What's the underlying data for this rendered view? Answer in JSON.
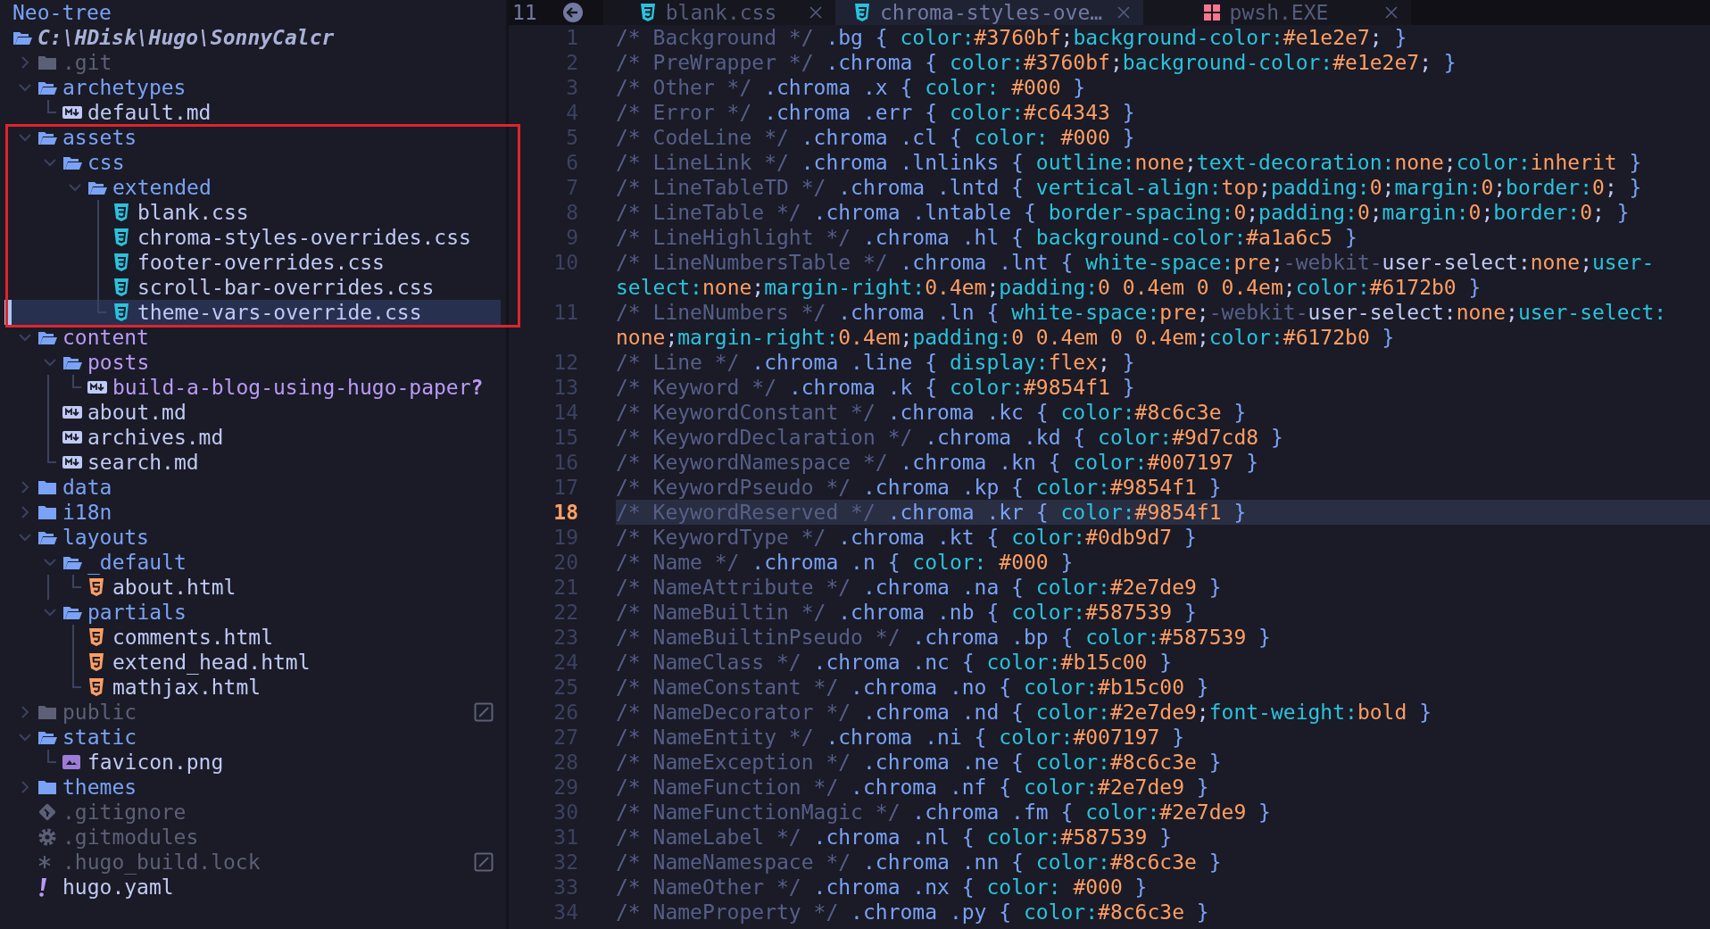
{
  "tree": {
    "title": "Neo-tree",
    "root": "C:\\HDisk\\Hugo\\SonnyCalcr",
    "items": [
      {
        "name": ".git",
        "kind": "folder",
        "expanded": false,
        "ignored": true,
        "untracked": false,
        "selected": false,
        "flagged": false,
        "framed": false
      },
      {
        "name": "archetypes",
        "kind": "folder",
        "expanded": true,
        "ignored": false,
        "untracked": false,
        "selected": false,
        "flagged": false,
        "framed": false,
        "children": [
          {
            "name": "default.md",
            "kind": "md",
            "ignored": false,
            "untracked": false,
            "selected": false,
            "flagged": false
          }
        ]
      },
      {
        "name": "assets",
        "kind": "folder",
        "expanded": true,
        "ignored": false,
        "untracked": false,
        "selected": false,
        "flagged": false,
        "framed": true,
        "children": [
          {
            "name": "css",
            "kind": "folder",
            "expanded": true,
            "ignored": false,
            "untracked": false,
            "selected": false,
            "flagged": false,
            "children": [
              {
                "name": "extended",
                "kind": "folder",
                "expanded": true,
                "ignored": false,
                "untracked": false,
                "selected": false,
                "flagged": false,
                "children": [
                  {
                    "name": "blank.css",
                    "kind": "css",
                    "ignored": false,
                    "untracked": false,
                    "selected": false,
                    "flagged": false
                  },
                  {
                    "name": "chroma-styles-overrides.css",
                    "kind": "css",
                    "ignored": false,
                    "untracked": false,
                    "selected": false,
                    "flagged": false
                  },
                  {
                    "name": "footer-overrides.css",
                    "kind": "css",
                    "ignored": false,
                    "untracked": false,
                    "selected": false,
                    "flagged": false
                  },
                  {
                    "name": "scroll-bar-overrides.css",
                    "kind": "css",
                    "ignored": false,
                    "untracked": false,
                    "selected": false,
                    "flagged": false
                  },
                  {
                    "name": "theme-vars-override.css",
                    "kind": "css",
                    "ignored": false,
                    "untracked": false,
                    "selected": true,
                    "flagged": false
                  }
                ]
              }
            ]
          }
        ]
      },
      {
        "name": "content",
        "kind": "folder",
        "expanded": true,
        "ignored": false,
        "untracked": true,
        "selected": false,
        "flagged": false,
        "framed": false,
        "children": [
          {
            "name": "posts",
            "kind": "folder",
            "expanded": true,
            "ignored": false,
            "untracked": true,
            "selected": false,
            "flagged": false,
            "children": [
              {
                "name": "build-a-blog-using-hugo-paper",
                "kind": "md",
                "ignored": false,
                "untracked": true,
                "status_mark": "?",
                "selected": false,
                "flagged": false
              }
            ]
          },
          {
            "name": "about.md",
            "kind": "md",
            "ignored": false,
            "untracked": false,
            "selected": false,
            "flagged": false
          },
          {
            "name": "archives.md",
            "kind": "md",
            "ignored": false,
            "untracked": false,
            "selected": false,
            "flagged": false
          },
          {
            "name": "search.md",
            "kind": "md",
            "ignored": false,
            "untracked": false,
            "selected": false,
            "flagged": false
          }
        ]
      },
      {
        "name": "data",
        "kind": "folder",
        "expanded": false,
        "ignored": false,
        "untracked": false,
        "selected": false,
        "flagged": false,
        "framed": false
      },
      {
        "name": "i18n",
        "kind": "folder",
        "expanded": false,
        "ignored": false,
        "untracked": false,
        "selected": false,
        "flagged": false,
        "framed": false
      },
      {
        "name": "layouts",
        "kind": "folder",
        "expanded": true,
        "ignored": false,
        "untracked": false,
        "selected": false,
        "flagged": false,
        "framed": false,
        "children": [
          {
            "name": "_default",
            "kind": "folder",
            "expanded": true,
            "ignored": false,
            "untracked": false,
            "selected": false,
            "flagged": false,
            "children": [
              {
                "name": "about.html",
                "kind": "html",
                "ignored": false,
                "untracked": false,
                "selected": false,
                "flagged": false
              }
            ]
          },
          {
            "name": "partials",
            "kind": "folder",
            "expanded": true,
            "ignored": false,
            "untracked": false,
            "selected": false,
            "flagged": false,
            "children": [
              {
                "name": "comments.html",
                "kind": "html",
                "ignored": false,
                "untracked": false,
                "selected": false,
                "flagged": false
              },
              {
                "name": "extend_head.html",
                "kind": "html",
                "ignored": false,
                "untracked": false,
                "selected": false,
                "flagged": false
              },
              {
                "name": "mathjax.html",
                "kind": "html",
                "ignored": false,
                "untracked": false,
                "selected": false,
                "flagged": false
              }
            ]
          }
        ]
      },
      {
        "name": "public",
        "kind": "folder",
        "expanded": false,
        "ignored": true,
        "untracked": false,
        "selected": false,
        "flagged": true,
        "framed": false
      },
      {
        "name": "static",
        "kind": "folder",
        "expanded": true,
        "ignored": false,
        "untracked": false,
        "selected": false,
        "flagged": false,
        "framed": false,
        "children": [
          {
            "name": "favicon.png",
            "kind": "png",
            "ignored": false,
            "untracked": false,
            "selected": false,
            "flagged": false
          }
        ]
      },
      {
        "name": "themes",
        "kind": "folder",
        "expanded": false,
        "ignored": false,
        "untracked": false,
        "selected": false,
        "flagged": false,
        "framed": false
      },
      {
        "name": ".gitignore",
        "kind": "git",
        "ignored": true,
        "untracked": false,
        "selected": false,
        "flagged": false,
        "framed": false
      },
      {
        "name": ".gitmodules",
        "kind": "config",
        "ignored": true,
        "untracked": false,
        "selected": false,
        "flagged": false,
        "framed": false
      },
      {
        "name": ".hugo_build.lock",
        "kind": "lock",
        "ignored": true,
        "untracked": false,
        "selected": false,
        "flagged": true,
        "framed": false
      },
      {
        "name": "hugo.yaml",
        "kind": "yaml",
        "ignored": false,
        "untracked": false,
        "selected": false,
        "flagged": false,
        "framed": false
      }
    ]
  },
  "tabline": {
    "buffer_number": "11",
    "tabs": [
      {
        "label": "blank.css",
        "kind": "css",
        "selected": false
      },
      {
        "label": "chroma-styles-ove…",
        "kind": "css",
        "selected": true
      },
      {
        "label": "pwsh.EXE",
        "kind": "terminal",
        "selected": false
      }
    ]
  },
  "editor": {
    "lines": [
      {
        "number": "1",
        "current": false,
        "tokens": [
          {
            "kind": "comment",
            "text": "/* Background */ "
          },
          {
            "kind": "selector",
            "text": ".bg { "
          },
          {
            "kind": "property",
            "text": "color:"
          },
          {
            "kind": "value",
            "text": "#3760bf"
          },
          {
            "kind": "punct",
            "text": ";"
          },
          {
            "kind": "property",
            "text": "background-color:"
          },
          {
            "kind": "value",
            "text": "#e1e2e7"
          },
          {
            "kind": "punct",
            "text": "; "
          },
          {
            "kind": "selector",
            "text": "}"
          }
        ]
      },
      {
        "number": "2",
        "current": false,
        "tokens": [
          {
            "kind": "comment",
            "text": "/* PreWrapper */ "
          },
          {
            "kind": "selector",
            "text": ".chroma { "
          },
          {
            "kind": "property",
            "text": "color:"
          },
          {
            "kind": "value",
            "text": "#3760bf"
          },
          {
            "kind": "punct",
            "text": ";"
          },
          {
            "kind": "property",
            "text": "background-color:"
          },
          {
            "kind": "value",
            "text": "#e1e2e7"
          },
          {
            "kind": "punct",
            "text": "; "
          },
          {
            "kind": "selector",
            "text": "}"
          }
        ]
      },
      {
        "number": "3",
        "current": false,
        "tokens": [
          {
            "kind": "comment",
            "text": "/* Other */ "
          },
          {
            "kind": "selector",
            "text": ".chroma .x { "
          },
          {
            "kind": "property",
            "text": "color: "
          },
          {
            "kind": "value",
            "text": "#000"
          },
          {
            "kind": "selector",
            "text": " }"
          }
        ]
      },
      {
        "number": "4",
        "current": false,
        "tokens": [
          {
            "kind": "comment",
            "text": "/* Error */ "
          },
          {
            "kind": "selector",
            "text": ".chroma .err { "
          },
          {
            "kind": "property",
            "text": "color:"
          },
          {
            "kind": "value",
            "text": "#c64343"
          },
          {
            "kind": "selector",
            "text": " }"
          }
        ]
      },
      {
        "number": "5",
        "current": false,
        "tokens": [
          {
            "kind": "comment",
            "text": "/* CodeLine */ "
          },
          {
            "kind": "selector",
            "text": ".chroma .cl { "
          },
          {
            "kind": "property",
            "text": "color: "
          },
          {
            "kind": "value",
            "text": "#000"
          },
          {
            "kind": "selector",
            "text": " }"
          }
        ]
      },
      {
        "number": "6",
        "current": false,
        "tokens": [
          {
            "kind": "comment",
            "text": "/* LineLink */ "
          },
          {
            "kind": "selector",
            "text": ".chroma .lnlinks { "
          },
          {
            "kind": "property",
            "text": "outline:"
          },
          {
            "kind": "value",
            "text": "none"
          },
          {
            "kind": "punct",
            "text": ";"
          },
          {
            "kind": "property",
            "text": "text-decoration:"
          },
          {
            "kind": "value",
            "text": "none"
          },
          {
            "kind": "punct",
            "text": ";"
          },
          {
            "kind": "property",
            "text": "color:"
          },
          {
            "kind": "value",
            "text": "inherit"
          },
          {
            "kind": "selector",
            "text": " }"
          }
        ]
      },
      {
        "number": "7",
        "current": false,
        "tokens": [
          {
            "kind": "comment",
            "text": "/* LineTableTD */ "
          },
          {
            "kind": "selector",
            "text": ".chroma .lntd { "
          },
          {
            "kind": "property",
            "text": "vertical-align:"
          },
          {
            "kind": "value",
            "text": "top"
          },
          {
            "kind": "punct",
            "text": ";"
          },
          {
            "kind": "property",
            "text": "padding:"
          },
          {
            "kind": "value",
            "text": "0"
          },
          {
            "kind": "punct",
            "text": ";"
          },
          {
            "kind": "property",
            "text": "margin:"
          },
          {
            "kind": "value",
            "text": "0"
          },
          {
            "kind": "punct",
            "text": ";"
          },
          {
            "kind": "property",
            "text": "border:"
          },
          {
            "kind": "value",
            "text": "0"
          },
          {
            "kind": "punct",
            "text": "; "
          },
          {
            "kind": "selector",
            "text": "}"
          }
        ]
      },
      {
        "number": "8",
        "current": false,
        "tokens": [
          {
            "kind": "comment",
            "text": "/* LineTable */ "
          },
          {
            "kind": "selector",
            "text": ".chroma .lntable { "
          },
          {
            "kind": "property",
            "text": "border-spacing:"
          },
          {
            "kind": "value",
            "text": "0"
          },
          {
            "kind": "punct",
            "text": ";"
          },
          {
            "kind": "property",
            "text": "padding:"
          },
          {
            "kind": "value",
            "text": "0"
          },
          {
            "kind": "punct",
            "text": ";"
          },
          {
            "kind": "property",
            "text": "margin:"
          },
          {
            "kind": "value",
            "text": "0"
          },
          {
            "kind": "punct",
            "text": ";"
          },
          {
            "kind": "property",
            "text": "border:"
          },
          {
            "kind": "value",
            "text": "0"
          },
          {
            "kind": "punct",
            "text": "; "
          },
          {
            "kind": "selector",
            "text": "}"
          }
        ]
      },
      {
        "number": "9",
        "current": false,
        "tokens": [
          {
            "kind": "comment",
            "text": "/* LineHighlight */ "
          },
          {
            "kind": "selector",
            "text": ".chroma .hl { "
          },
          {
            "kind": "property",
            "text": "background-color:"
          },
          {
            "kind": "value",
            "text": "#a1a6c5"
          },
          {
            "kind": "selector",
            "text": " }"
          }
        ]
      },
      {
        "number": "10",
        "current": false,
        "tokens": [
          {
            "kind": "comment",
            "text": "/* LineNumbersTable */ "
          },
          {
            "kind": "selector",
            "text": ".chroma .lnt { "
          },
          {
            "kind": "property",
            "text": "white-space:"
          },
          {
            "kind": "value",
            "text": "pre"
          },
          {
            "kind": "punct",
            "text": ";"
          },
          {
            "kind": "vendor",
            "text": "-webkit-"
          },
          {
            "kind": "plain",
            "text": "user-select:"
          },
          {
            "kind": "value",
            "text": "none"
          },
          {
            "kind": "punct",
            "text": ";"
          },
          {
            "kind": "property",
            "text": "user-"
          }
        ],
        "wrapped": [
          {
            "kind": "property",
            "text": "select:"
          },
          {
            "kind": "value",
            "text": "none"
          },
          {
            "kind": "punct",
            "text": ";"
          },
          {
            "kind": "property",
            "text": "margin-right:"
          },
          {
            "kind": "value",
            "text": "0.4em"
          },
          {
            "kind": "punct",
            "text": ";"
          },
          {
            "kind": "property",
            "text": "padding:"
          },
          {
            "kind": "value",
            "text": "0 0.4em 0 0.4em"
          },
          {
            "kind": "punct",
            "text": ";"
          },
          {
            "kind": "property",
            "text": "color:"
          },
          {
            "kind": "value",
            "text": "#6172b0"
          },
          {
            "kind": "selector",
            "text": " }"
          }
        ]
      },
      {
        "number": "11",
        "current": false,
        "tokens": [
          {
            "kind": "comment",
            "text": "/* LineNumbers */ "
          },
          {
            "kind": "selector",
            "text": ".chroma .ln { "
          },
          {
            "kind": "property",
            "text": "white-space:"
          },
          {
            "kind": "value",
            "text": "pre"
          },
          {
            "kind": "punct",
            "text": ";"
          },
          {
            "kind": "vendor",
            "text": "-webkit-"
          },
          {
            "kind": "plain",
            "text": "user-select:"
          },
          {
            "kind": "value",
            "text": "none"
          },
          {
            "kind": "punct",
            "text": ";"
          },
          {
            "kind": "property",
            "text": "user-select:"
          }
        ],
        "wrapped": [
          {
            "kind": "value",
            "text": "none"
          },
          {
            "kind": "punct",
            "text": ";"
          },
          {
            "kind": "property",
            "text": "margin-right:"
          },
          {
            "kind": "value",
            "text": "0.4em"
          },
          {
            "kind": "punct",
            "text": ";"
          },
          {
            "kind": "property",
            "text": "padding:"
          },
          {
            "kind": "value",
            "text": "0 0.4em 0 0.4em"
          },
          {
            "kind": "punct",
            "text": ";"
          },
          {
            "kind": "property",
            "text": "color:"
          },
          {
            "kind": "value",
            "text": "#6172b0"
          },
          {
            "kind": "selector",
            "text": " }"
          }
        ]
      },
      {
        "number": "12",
        "current": false,
        "tokens": [
          {
            "kind": "comment",
            "text": "/* Line */ "
          },
          {
            "kind": "selector",
            "text": ".chroma .line { "
          },
          {
            "kind": "property",
            "text": "display:"
          },
          {
            "kind": "value",
            "text": "flex"
          },
          {
            "kind": "punct",
            "text": "; "
          },
          {
            "kind": "selector",
            "text": "}"
          }
        ]
      },
      {
        "number": "13",
        "current": false,
        "tokens": [
          {
            "kind": "comment",
            "text": "/* Keyword */ "
          },
          {
            "kind": "selector",
            "text": ".chroma .k { "
          },
          {
            "kind": "property",
            "text": "color:"
          },
          {
            "kind": "value",
            "text": "#9854f1"
          },
          {
            "kind": "selector",
            "text": " }"
          }
        ]
      },
      {
        "number": "14",
        "current": false,
        "tokens": [
          {
            "kind": "comment",
            "text": "/* KeywordConstant */ "
          },
          {
            "kind": "selector",
            "text": ".chroma .kc { "
          },
          {
            "kind": "property",
            "text": "color:"
          },
          {
            "kind": "value",
            "text": "#8c6c3e"
          },
          {
            "kind": "selector",
            "text": " }"
          }
        ]
      },
      {
        "number": "15",
        "current": false,
        "tokens": [
          {
            "kind": "comment",
            "text": "/* KeywordDeclaration */ "
          },
          {
            "kind": "selector",
            "text": ".chroma .kd { "
          },
          {
            "kind": "property",
            "text": "color:"
          },
          {
            "kind": "value",
            "text": "#9d7cd8"
          },
          {
            "kind": "selector",
            "text": " }"
          }
        ]
      },
      {
        "number": "16",
        "current": false,
        "tokens": [
          {
            "kind": "comment",
            "text": "/* KeywordNamespace */ "
          },
          {
            "kind": "selector",
            "text": ".chroma .kn { "
          },
          {
            "kind": "property",
            "text": "color:"
          },
          {
            "kind": "value",
            "text": "#007197"
          },
          {
            "kind": "selector",
            "text": " }"
          }
        ]
      },
      {
        "number": "17",
        "current": false,
        "tokens": [
          {
            "kind": "comment",
            "text": "/* KeywordPseudo */ "
          },
          {
            "kind": "selector",
            "text": ".chroma .kp { "
          },
          {
            "kind": "property",
            "text": "color:"
          },
          {
            "kind": "value",
            "text": "#9854f1"
          },
          {
            "kind": "selector",
            "text": " }"
          }
        ]
      },
      {
        "number": "18",
        "current": true,
        "tokens": [
          {
            "kind": "comment",
            "text": "/* KeywordReserved */ "
          },
          {
            "kind": "selector",
            "text": ".chroma .kr { "
          },
          {
            "kind": "property",
            "text": "color:"
          },
          {
            "kind": "value",
            "text": "#9854f1"
          },
          {
            "kind": "selector",
            "text": " }"
          }
        ]
      },
      {
        "number": "19",
        "current": false,
        "tokens": [
          {
            "kind": "comment",
            "text": "/* KeywordType */ "
          },
          {
            "kind": "selector",
            "text": ".chroma .kt { "
          },
          {
            "kind": "property",
            "text": "color:"
          },
          {
            "kind": "value",
            "text": "#0db9d7"
          },
          {
            "kind": "selector",
            "text": " }"
          }
        ]
      },
      {
        "number": "20",
        "current": false,
        "tokens": [
          {
            "kind": "comment",
            "text": "/* Name */ "
          },
          {
            "kind": "selector",
            "text": ".chroma .n { "
          },
          {
            "kind": "property",
            "text": "color: "
          },
          {
            "kind": "value",
            "text": "#000"
          },
          {
            "kind": "selector",
            "text": " }"
          }
        ]
      },
      {
        "number": "21",
        "current": false,
        "tokens": [
          {
            "kind": "comment",
            "text": "/* NameAttribute */ "
          },
          {
            "kind": "selector",
            "text": ".chroma .na { "
          },
          {
            "kind": "property",
            "text": "color:"
          },
          {
            "kind": "value",
            "text": "#2e7de9"
          },
          {
            "kind": "selector",
            "text": " }"
          }
        ]
      },
      {
        "number": "22",
        "current": false,
        "tokens": [
          {
            "kind": "comment",
            "text": "/* NameBuiltin */ "
          },
          {
            "kind": "selector",
            "text": ".chroma .nb { "
          },
          {
            "kind": "property",
            "text": "color:"
          },
          {
            "kind": "value",
            "text": "#587539"
          },
          {
            "kind": "selector",
            "text": " }"
          }
        ]
      },
      {
        "number": "23",
        "current": false,
        "tokens": [
          {
            "kind": "comment",
            "text": "/* NameBuiltinPseudo */ "
          },
          {
            "kind": "selector",
            "text": ".chroma .bp { "
          },
          {
            "kind": "property",
            "text": "color:"
          },
          {
            "kind": "value",
            "text": "#587539"
          },
          {
            "kind": "selector",
            "text": " }"
          }
        ]
      },
      {
        "number": "24",
        "current": false,
        "tokens": [
          {
            "kind": "comment",
            "text": "/* NameClass */ "
          },
          {
            "kind": "selector",
            "text": ".chroma .nc { "
          },
          {
            "kind": "property",
            "text": "color:"
          },
          {
            "kind": "value",
            "text": "#b15c00"
          },
          {
            "kind": "selector",
            "text": " }"
          }
        ]
      },
      {
        "number": "25",
        "current": false,
        "tokens": [
          {
            "kind": "comment",
            "text": "/* NameConstant */ "
          },
          {
            "kind": "selector",
            "text": ".chroma .no { "
          },
          {
            "kind": "property",
            "text": "color:"
          },
          {
            "kind": "value",
            "text": "#b15c00"
          },
          {
            "kind": "selector",
            "text": " }"
          }
        ]
      },
      {
        "number": "26",
        "current": false,
        "tokens": [
          {
            "kind": "comment",
            "text": "/* NameDecorator */ "
          },
          {
            "kind": "selector",
            "text": ".chroma .nd { "
          },
          {
            "kind": "property",
            "text": "color:"
          },
          {
            "kind": "value",
            "text": "#2e7de9"
          },
          {
            "kind": "punct",
            "text": ";"
          },
          {
            "kind": "property",
            "text": "font-weight:"
          },
          {
            "kind": "value",
            "text": "bold"
          },
          {
            "kind": "selector",
            "text": " }"
          }
        ]
      },
      {
        "number": "27",
        "current": false,
        "tokens": [
          {
            "kind": "comment",
            "text": "/* NameEntity */ "
          },
          {
            "kind": "selector",
            "text": ".chroma .ni { "
          },
          {
            "kind": "property",
            "text": "color:"
          },
          {
            "kind": "value",
            "text": "#007197"
          },
          {
            "kind": "selector",
            "text": " }"
          }
        ]
      },
      {
        "number": "28",
        "current": false,
        "tokens": [
          {
            "kind": "comment",
            "text": "/* NameException */ "
          },
          {
            "kind": "selector",
            "text": ".chroma .ne { "
          },
          {
            "kind": "property",
            "text": "color:"
          },
          {
            "kind": "value",
            "text": "#8c6c3e"
          },
          {
            "kind": "selector",
            "text": " }"
          }
        ]
      },
      {
        "number": "29",
        "current": false,
        "tokens": [
          {
            "kind": "comment",
            "text": "/* NameFunction */ "
          },
          {
            "kind": "selector",
            "text": ".chroma .nf { "
          },
          {
            "kind": "property",
            "text": "color:"
          },
          {
            "kind": "value",
            "text": "#2e7de9"
          },
          {
            "kind": "selector",
            "text": " }"
          }
        ]
      },
      {
        "number": "30",
        "current": false,
        "tokens": [
          {
            "kind": "comment",
            "text": "/* NameFunctionMagic */ "
          },
          {
            "kind": "selector",
            "text": ".chroma .fm { "
          },
          {
            "kind": "property",
            "text": "color:"
          },
          {
            "kind": "value",
            "text": "#2e7de9"
          },
          {
            "kind": "selector",
            "text": " }"
          }
        ]
      },
      {
        "number": "31",
        "current": false,
        "tokens": [
          {
            "kind": "comment",
            "text": "/* NameLabel */ "
          },
          {
            "kind": "selector",
            "text": ".chroma .nl { "
          },
          {
            "kind": "property",
            "text": "color:"
          },
          {
            "kind": "value",
            "text": "#587539"
          },
          {
            "kind": "selector",
            "text": " }"
          }
        ]
      },
      {
        "number": "32",
        "current": false,
        "tokens": [
          {
            "kind": "comment",
            "text": "/* NameNamespace */ "
          },
          {
            "kind": "selector",
            "text": ".chroma .nn { "
          },
          {
            "kind": "property",
            "text": "color:"
          },
          {
            "kind": "value",
            "text": "#8c6c3e"
          },
          {
            "kind": "selector",
            "text": " }"
          }
        ]
      },
      {
        "number": "33",
        "current": false,
        "tokens": [
          {
            "kind": "comment",
            "text": "/* NameOther */ "
          },
          {
            "kind": "selector",
            "text": ".chroma .nx { "
          },
          {
            "kind": "property",
            "text": "color: "
          },
          {
            "kind": "value",
            "text": "#000"
          },
          {
            "kind": "selector",
            "text": " }"
          }
        ]
      },
      {
        "number": "34",
        "current": false,
        "tokens": [
          {
            "kind": "comment",
            "text": "/* NameProperty */ "
          },
          {
            "kind": "selector",
            "text": ".chroma .py { "
          },
          {
            "kind": "property",
            "text": "color:"
          },
          {
            "kind": "value",
            "text": "#8c6c3e"
          },
          {
            "kind": "selector",
            "text": " }"
          }
        ]
      }
    ]
  }
}
